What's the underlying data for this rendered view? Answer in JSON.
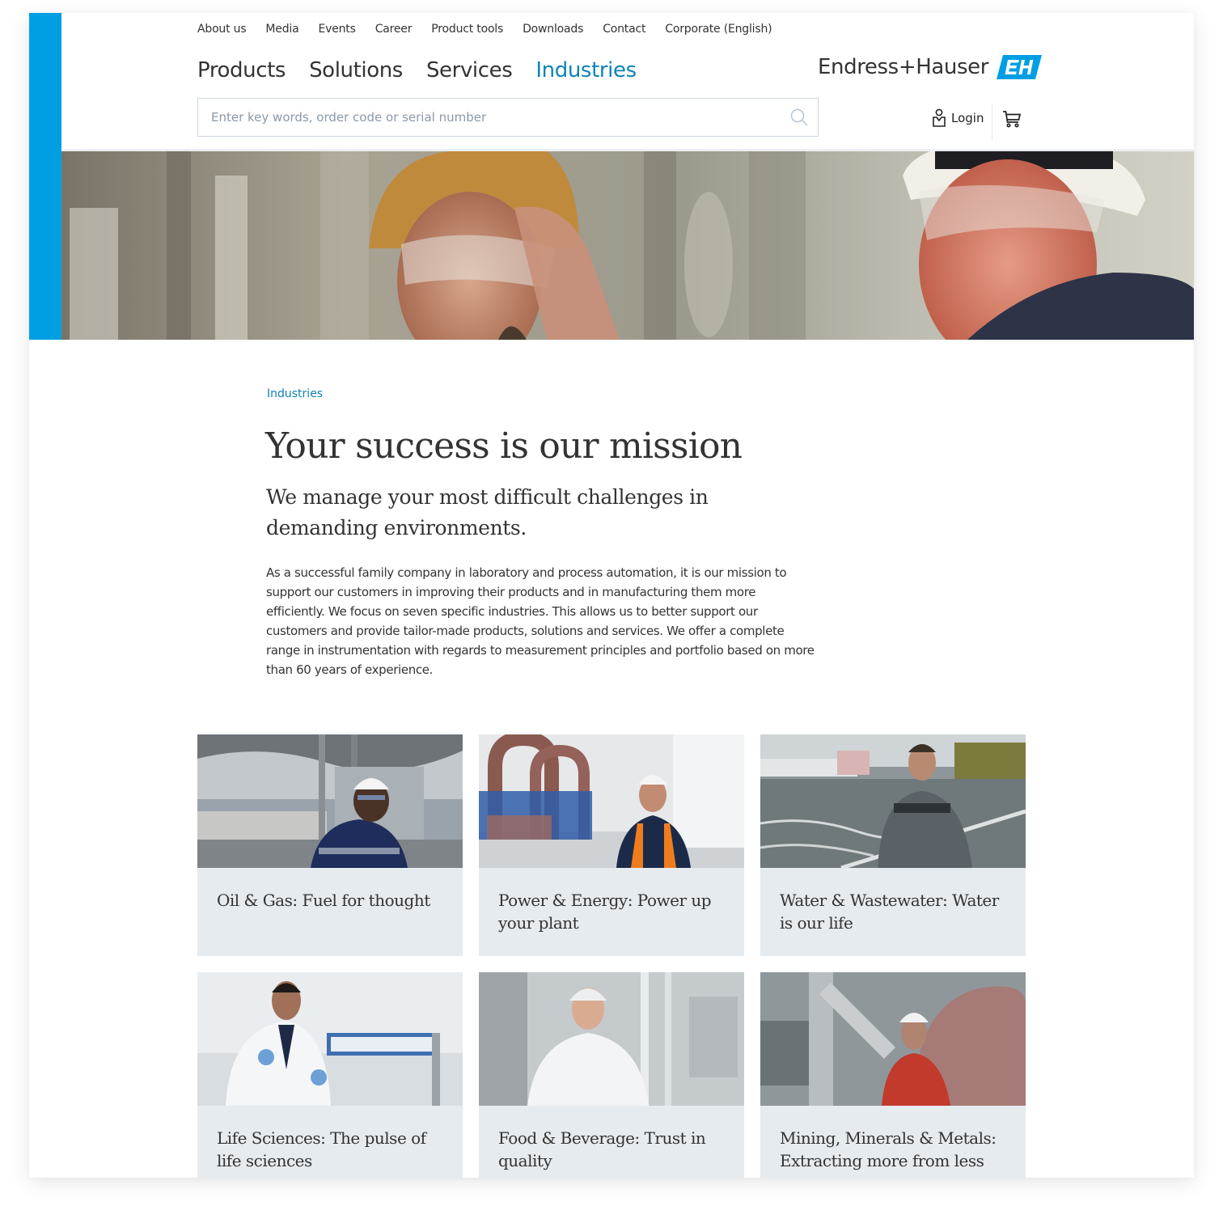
{
  "meta_nav": [
    "About us",
    "Media",
    "Events",
    "Career",
    "Product tools",
    "Downloads",
    "Contact",
    "Corporate (English)"
  ],
  "main_nav": [
    {
      "label": "Products",
      "active": false
    },
    {
      "label": "Solutions",
      "active": false
    },
    {
      "label": "Services",
      "active": false
    },
    {
      "label": "Industries",
      "active": true
    }
  ],
  "brand": {
    "name": "Endress+Hauser",
    "mark": "EH",
    "color": "#009fe3"
  },
  "search": {
    "placeholder": "Enter key words, order code or serial number",
    "value": "",
    "icon": "search-icon"
  },
  "account": {
    "login_label": "Login",
    "login_icon": "user-icon",
    "cart_icon": "cart-icon"
  },
  "hero": {
    "image": "two engineers in hard hats and safety glasses in an industrial plant"
  },
  "content": {
    "breadcrumb": "Industries",
    "title": "Your success is our mission",
    "subtitle": "We manage your most difficult challenges in demanding environments.",
    "body": "As a successful family company in laboratory and process automation, it is our mission to support our customers in improving their products and in manufacturing them more efficiently. We focus on seven specific industries. This allows us to better support our customers and provide tailor-made products, solutions and services. We offer a complete range in instrumentation with regards to measurement principles and portfolio based on more than 60 years of experience."
  },
  "industries": [
    {
      "label": "Oil & Gas: Fuel for thought",
      "image": "worker in white hard hat in front of refinery"
    },
    {
      "label": "Power & Energy: Power up your plant",
      "image": "worker in orange safety vest in turbine hall"
    },
    {
      "label": "Water & Wastewater: Water is our life",
      "image": "worker leaning on railing at wastewater basin"
    },
    {
      "label": "Life Sciences: The pulse of life sciences",
      "image": "scientist in lab coat with blue gloves"
    },
    {
      "label": "Food & Beverage: Trust in quality",
      "image": "worker in hairnet and white coat in food plant"
    },
    {
      "label": "Mining, Minerals & Metals: Extracting more from less",
      "image": "worker in red jacket and hard hat by machinery"
    }
  ],
  "colors": {
    "accent": "#0f83b6",
    "brand_blue": "#009fe3",
    "card_bg": "#e6ebef",
    "text": "#333333"
  }
}
